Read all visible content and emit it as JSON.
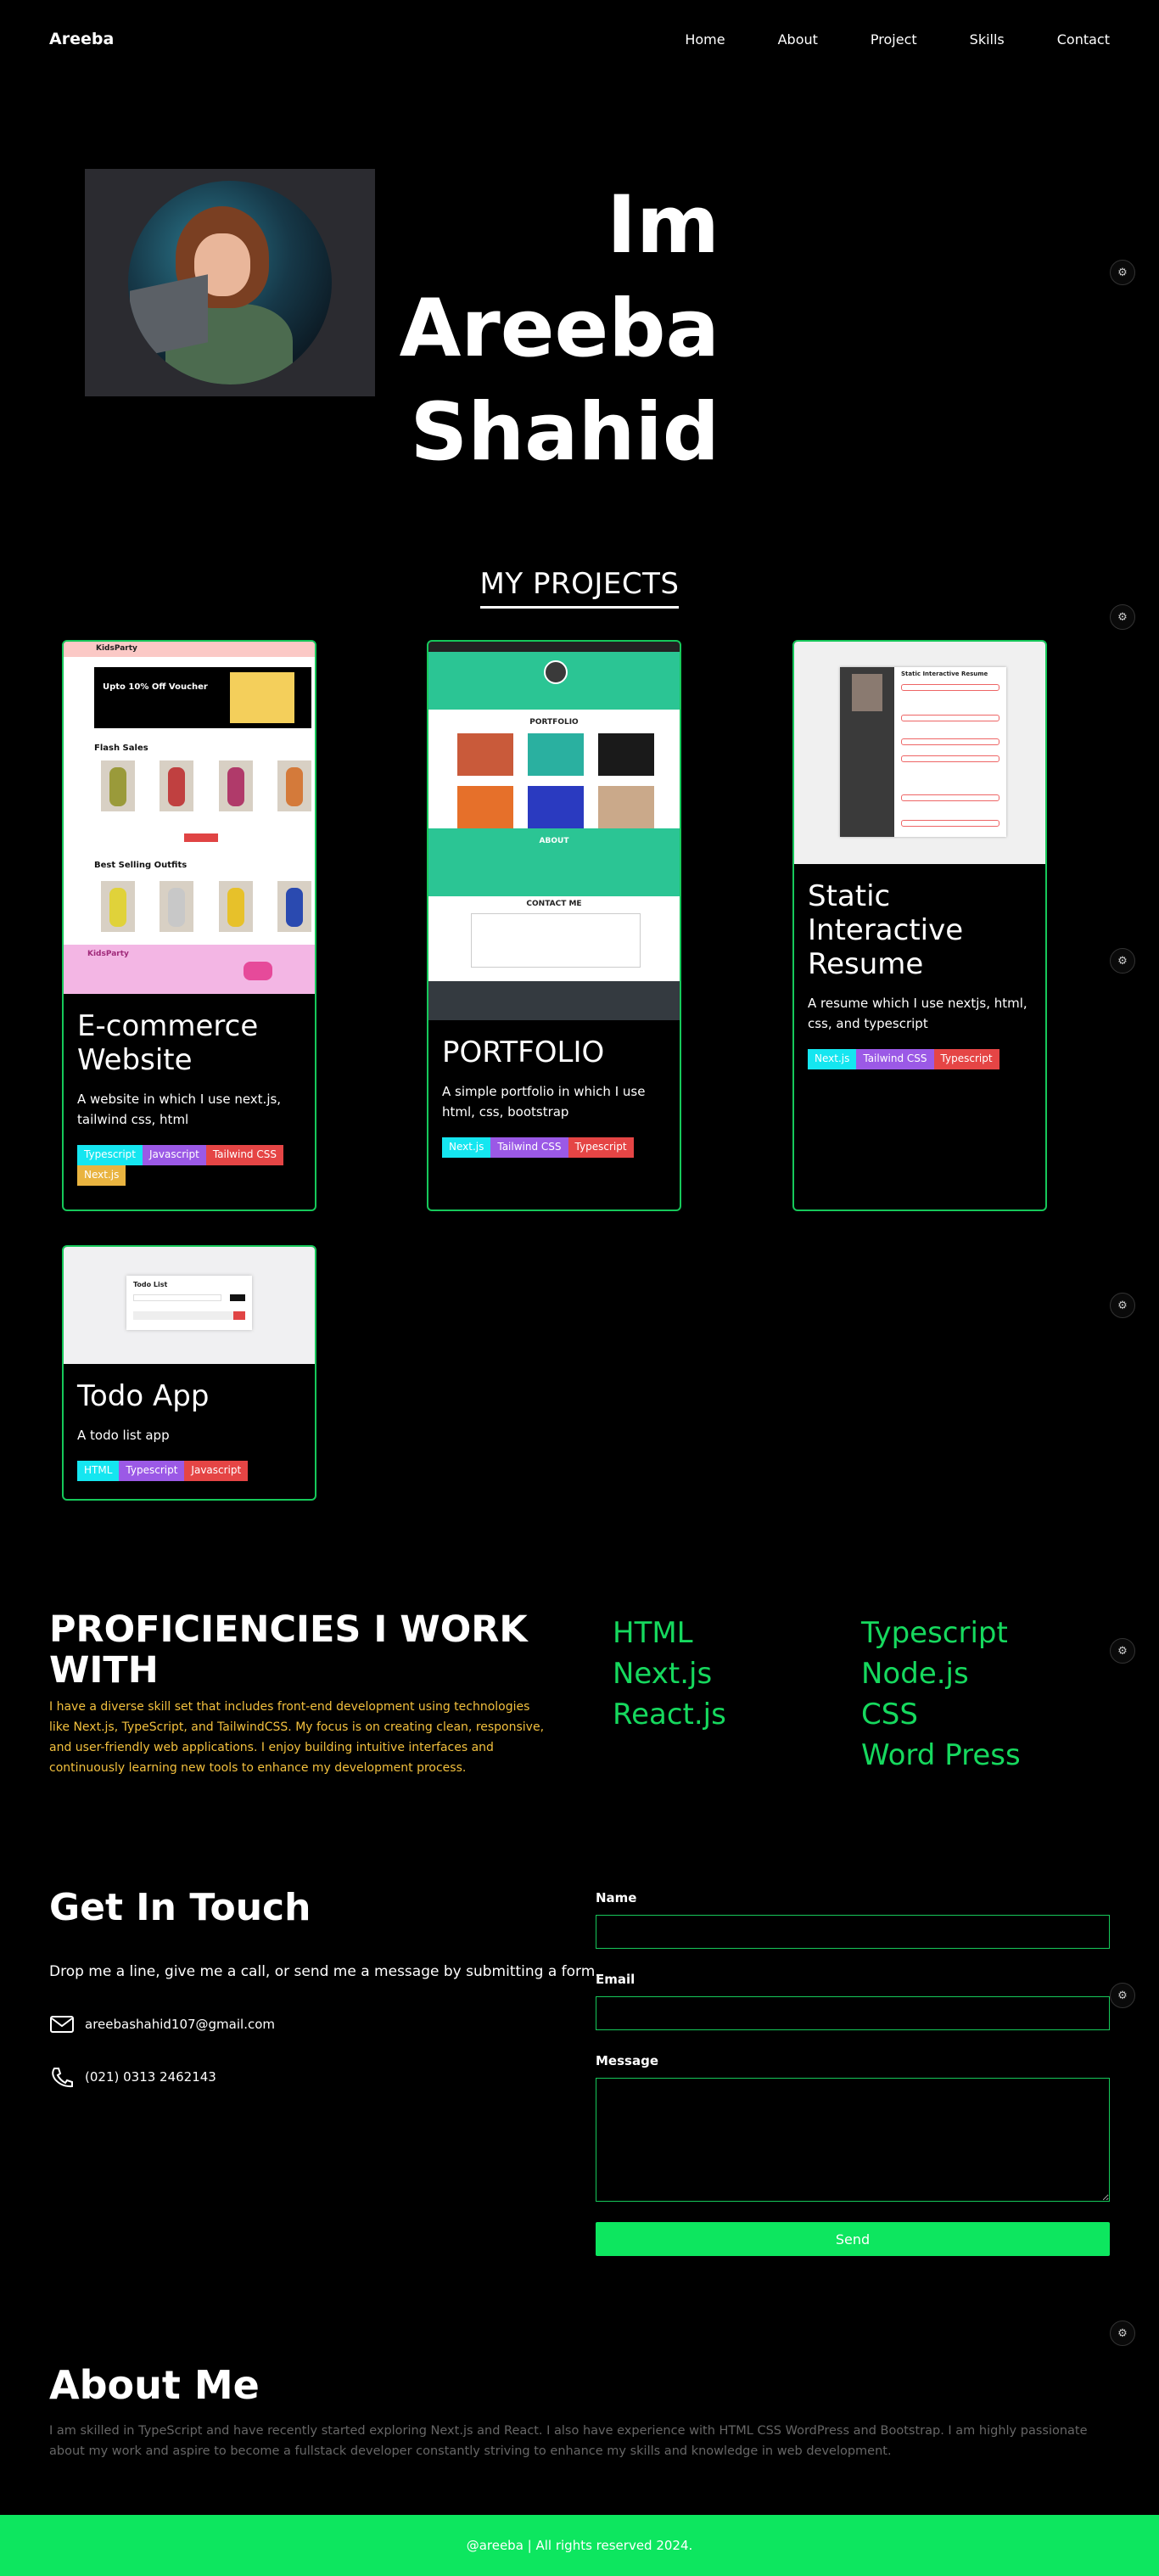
{
  "nav": {
    "logo": "Areeba",
    "links": [
      "Home",
      "About",
      "Project",
      "Skills",
      "Contact"
    ]
  },
  "hero": {
    "line1": "Im",
    "line2": "Areeba",
    "line3": "Shahid"
  },
  "projects": {
    "title": "MY PROJECTS",
    "items": [
      {
        "title": "E-commerce Website",
        "desc": "A website in which I use next.js, tailwind css, html",
        "tags": [
          "Typescript",
          "Javascript",
          "Tailwind CSS",
          "Next.js"
        ]
      },
      {
        "title": "PORTFOLIO",
        "desc": "A simple portfolio in which I use html, css, bootstrap",
        "tags": [
          "Next.js",
          "Tailwind CSS",
          "Typescript"
        ]
      },
      {
        "title": "Static Interactive Resume",
        "desc": "A resume which I use nextjs, html, css, and typescript",
        "tags": [
          "Next.js",
          "Tailwind CSS",
          "Typescript"
        ]
      },
      {
        "title": "Todo App",
        "desc": "A todo list app",
        "tags": [
          "HTML",
          "Typescript",
          "Javascript"
        ]
      }
    ],
    "screens": {
      "shop_name": "KidsParty",
      "voucher": "Upto 10% Off Voucher",
      "flash_sales": "Flash Sales",
      "best_selling": "Best Selling Outfits",
      "portfolio_heading": "PORTFOLIO",
      "about_heading": "ABOUT",
      "contact_heading": "CONTACT ME",
      "resume_heading": "Static Interactive Resume",
      "todo_heading": "Todo List"
    }
  },
  "proficiencies": {
    "title": "PROFICIENCIES I WORK WITH",
    "text": "I have a diverse skill set that includes front-end development using technologies like Next.js, TypeScript, and TailwindCSS. My focus is on creating clean, responsive, and user-friendly web applications. I enjoy building intuitive interfaces and continuously learning new tools to enhance my development process.",
    "col1": [
      "HTML",
      "Next.js",
      "React.js"
    ],
    "col2": [
      "Typescript",
      "Node.js",
      "CSS",
      "Word Press"
    ]
  },
  "contact": {
    "title": "Get In Touch",
    "subtitle": "Drop me a line, give me a call, or send me a message by submitting a form.",
    "email": "areebashahid107@gmail.com",
    "phone": "(021) 0313 2462143",
    "name_label": "Name",
    "email_label": "Email",
    "message_label": "Message",
    "send_label": "Send"
  },
  "about": {
    "title": "About Me",
    "text": "I am skilled in TypeScript and have recently started exploring Next.js and React. I also have experience with HTML CSS WordPress and Bootstrap. I am highly passionate about my work and aspire to become a fullstack developer constantly striving to enhance my skills and knowledge in web development."
  },
  "footer": {
    "text": "@areeba | All rights reserved 2024."
  },
  "colors": {
    "accent": "#16c85a",
    "send": "#0de65f",
    "proficiency_text": "#f2c03e"
  }
}
